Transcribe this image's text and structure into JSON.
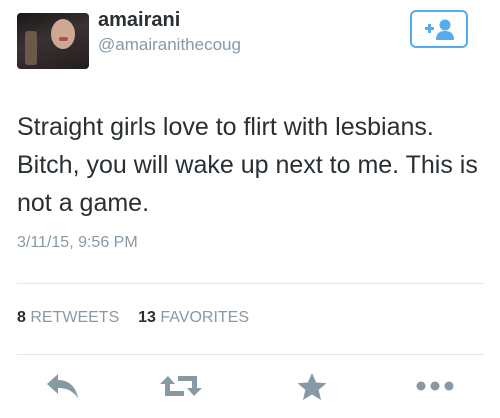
{
  "tweet": {
    "author_name": "amairani",
    "author_handle": "@amairanithecoug",
    "text": "Straight girls love to flirt with lesbians. Bitch, you will wake up next to me. This is not a game.",
    "timestamp": "3/11/15, 9:56 PM"
  },
  "stats": {
    "retweets_count": "8",
    "retweets_label": "RETWEETS",
    "favorites_count": "13",
    "favorites_label": "FAVORITES"
  },
  "icons": {
    "follow": "follow-plus-person-icon",
    "reply": "reply-icon",
    "retweet": "retweet-icon",
    "favorite": "star-icon",
    "more": "more-dots-icon"
  },
  "colors": {
    "accent": "#55acee",
    "text": "#292f33",
    "muted": "#8899a6",
    "icon": "#8899a6",
    "divider": "#e1e8ed"
  }
}
